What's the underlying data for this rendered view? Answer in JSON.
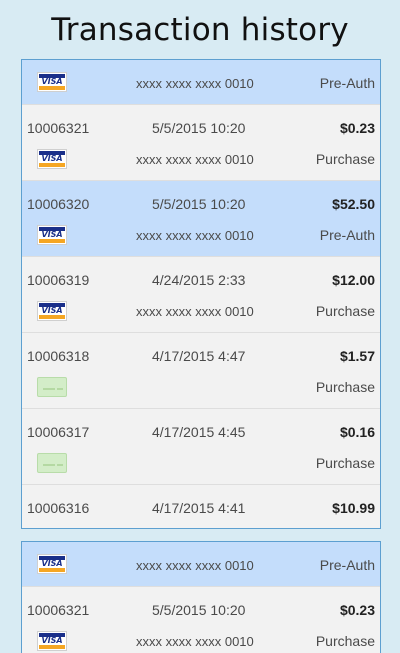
{
  "title": "Transaction history",
  "panel1": {
    "preauth": {
      "card_icon": "visa-icon",
      "card_brand": "VISA",
      "card_mask": "xxxx xxxx xxxx 0010",
      "type": "Pre-Auth"
    },
    "transactions": [
      {
        "id": "10006321",
        "date": "5/5/2015 10:20",
        "amount": "$0.23",
        "card_icon": "visa-icon",
        "card_brand": "VISA",
        "card_mask": "xxxx xxxx xxxx 0010",
        "type": "Purchase",
        "selected": false
      },
      {
        "id": "10006320",
        "date": "5/5/2015 10:20",
        "amount": "$52.50",
        "card_icon": "visa-icon",
        "card_brand": "VISA",
        "card_mask": "xxxx xxxx xxxx 0010",
        "type": "Pre-Auth",
        "selected": true
      },
      {
        "id": "10006319",
        "date": "4/24/2015 2:33",
        "amount": "$12.00",
        "card_icon": "visa-icon",
        "card_brand": "VISA",
        "card_mask": "xxxx xxxx xxxx 0010",
        "type": "Purchase",
        "selected": false
      },
      {
        "id": "10006318",
        "date": "4/17/2015 4:47",
        "amount": "$1.57",
        "card_icon": "card-icon",
        "card_brand": "",
        "card_mask": "",
        "type": "Purchase",
        "selected": false
      },
      {
        "id": "10006317",
        "date": "4/17/2015 4:45",
        "amount": "$0.16",
        "card_icon": "card-icon",
        "card_brand": "",
        "card_mask": "",
        "type": "Purchase",
        "selected": false
      },
      {
        "id": "10006316",
        "date": "4/17/2015 4:41",
        "amount": "$10.99",
        "card_icon": "card-icon",
        "card_brand": "",
        "card_mask": "",
        "type": "",
        "selected": false
      }
    ]
  },
  "panel2": {
    "preauth": {
      "card_icon": "visa-icon",
      "card_brand": "VISA",
      "card_mask": "xxxx xxxx xxxx 0010",
      "type": "Pre-Auth"
    },
    "transactions": [
      {
        "id": "10006321",
        "date": "5/5/2015 10:20",
        "amount": "$0.23",
        "card_icon": "visa-icon",
        "card_brand": "VISA",
        "card_mask": "xxxx xxxx xxxx 0010",
        "type": "Purchase",
        "selected": false
      }
    ]
  },
  "colors": {
    "selected_row": "#c4ddfb",
    "background": "#d8ebf3",
    "panel_border": "#5d9fd0"
  }
}
